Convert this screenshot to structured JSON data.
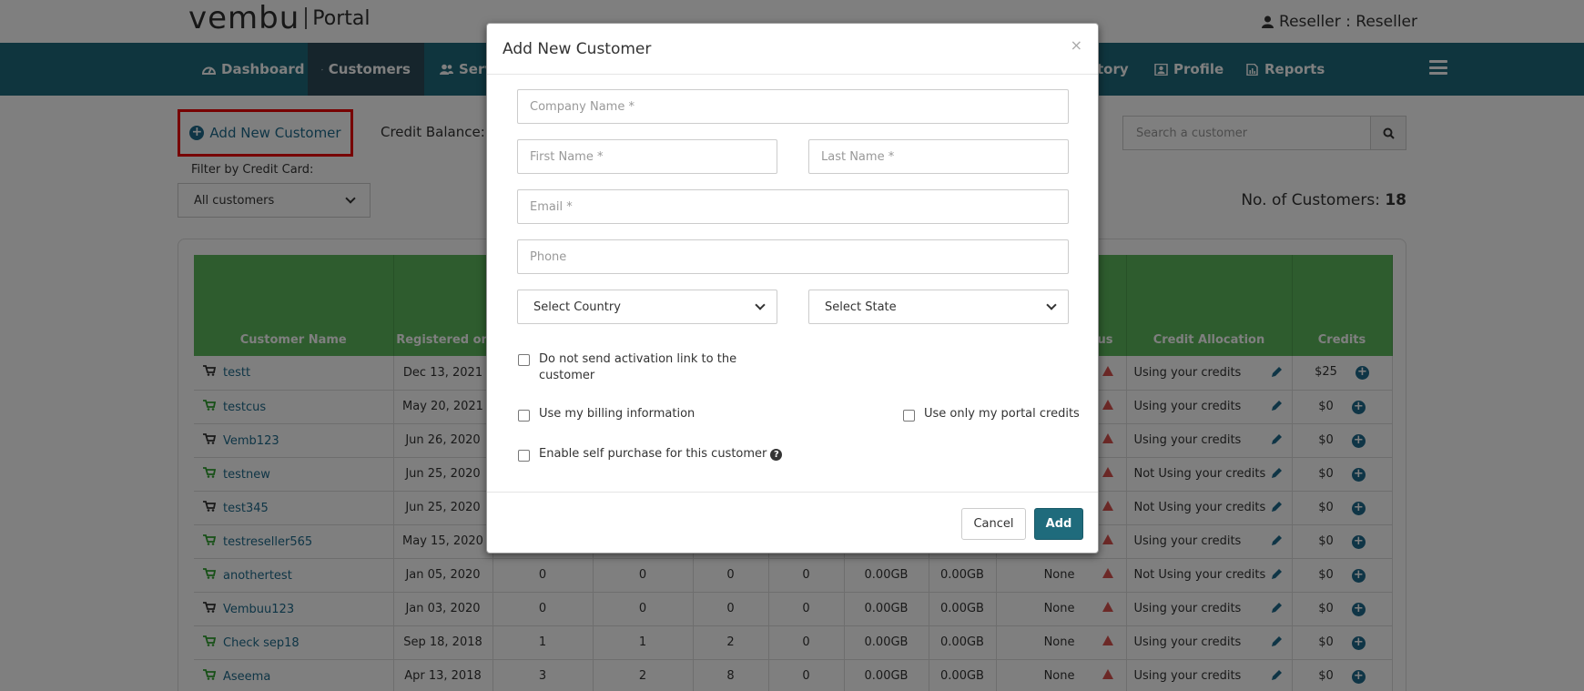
{
  "header": {
    "logo_brand": "vembu",
    "logo_portal": "Portal",
    "user_label": "Reseller : Reseller",
    "nav": [
      {
        "label": "Dashboard"
      },
      {
        "label": "Customers"
      },
      {
        "label": "Serv"
      },
      {
        "label": "tory"
      },
      {
        "label": "Profile"
      },
      {
        "label": "Reports"
      }
    ]
  },
  "toolbar": {
    "add_customer_label": "Add New Customer",
    "credit_balance_label": "Credit Balance:",
    "filter_label": "Filter by Credit Card:",
    "filter_value": "All customers",
    "search_placeholder": "Search a customer",
    "count_label": "No. of Customers:",
    "count_value": "18"
  },
  "table": {
    "columns": [
      "Customer Name",
      "Registered on",
      "",
      "",
      "",
      "",
      "",
      "",
      "us",
      "Credit Allocation",
      "Credits"
    ],
    "rows": [
      {
        "name": "testt",
        "cart_color": "#333333",
        "registered": "Dec 13, 2021",
        "c1": "",
        "c2": "",
        "c3": "",
        "c4": "",
        "c5": "",
        "c6": "",
        "c7": "",
        "alloc": "Using your credits",
        "credits": "$25"
      },
      {
        "name": "testcus",
        "cart_color": "#2ea12e",
        "registered": "May 20, 2021",
        "c1": "",
        "c2": "",
        "c3": "",
        "c4": "",
        "c5": "",
        "c6": "",
        "c7": "",
        "alloc": "Using your credits",
        "credits": "$0"
      },
      {
        "name": "Vemb123",
        "cart_color": "#333333",
        "registered": "Jun 26, 2020",
        "c1": "",
        "c2": "",
        "c3": "",
        "c4": "",
        "c5": "",
        "c6": "",
        "c7": "",
        "alloc": "Using your credits",
        "credits": "$0"
      },
      {
        "name": "testnew",
        "cart_color": "#2ea12e",
        "registered": "Jun 25, 2020",
        "c1": "",
        "c2": "",
        "c3": "",
        "c4": "",
        "c5": "",
        "c6": "",
        "c7": "",
        "alloc": "Not Using your credits",
        "credits": "$0"
      },
      {
        "name": "test345",
        "cart_color": "#333333",
        "registered": "Jun 25, 2020",
        "c1": "",
        "c2": "",
        "c3": "",
        "c4": "",
        "c5": "",
        "c6": "",
        "c7": "",
        "alloc": "Not Using your credits",
        "credits": "$0"
      },
      {
        "name": "testreseller565",
        "cart_color": "#2ea12e",
        "registered": "May 15, 2020",
        "c1": "",
        "c2": "",
        "c3": "",
        "c4": "",
        "c5": "",
        "c6": "",
        "c7": "",
        "alloc": "Using your credits",
        "credits": "$0"
      },
      {
        "name": "anothertest",
        "cart_color": "#2ea12e",
        "registered": "Jan 05, 2020",
        "c1": "0",
        "c2": "0",
        "c3": "0",
        "c4": "0",
        "c5": "0.00GB",
        "c6": "0.00GB",
        "c7": "None",
        "alloc": "Not Using your credits",
        "credits": "$0"
      },
      {
        "name": "Vembuu123",
        "cart_color": "#333333",
        "registered": "Jan 03, 2020",
        "c1": "0",
        "c2": "0",
        "c3": "0",
        "c4": "0",
        "c5": "0.00GB",
        "c6": "0.00GB",
        "c7": "None",
        "alloc": "Using your credits",
        "credits": "$0"
      },
      {
        "name": "Check sep18",
        "cart_color": "#2ea12e",
        "registered": "Sep 18, 2018",
        "c1": "1",
        "c2": "1",
        "c3": "2",
        "c4": "0",
        "c5": "0.00GB",
        "c6": "0.00GB",
        "c7": "None",
        "alloc": "Using your credits",
        "credits": "$0"
      },
      {
        "name": "Aseema",
        "cart_color": "#2ea12e",
        "registered": "Apr 13, 2018",
        "c1": "3",
        "c2": "2",
        "c3": "8",
        "c4": "0",
        "c5": "0.00GB",
        "c6": "0.00GB",
        "c7": "None",
        "alloc": "Using your credits",
        "credits": "$0"
      }
    ]
  },
  "modal": {
    "title": "Add New Customer",
    "close": "×",
    "company_placeholder": "Company  Name *",
    "first_name_placeholder": "First Name *",
    "last_name_placeholder": "Last Name *",
    "email_placeholder": "Email *",
    "phone_placeholder": "Phone",
    "country_value": "Select Country",
    "state_value": "Select State",
    "check_activation_line1": "Do not send activation link to the",
    "check_activation_line2": "customer",
    "check_billing": "Use my billing information",
    "check_portal_credits": "Use only my portal credits",
    "check_self_purchase": "Enable self purchase for this customer",
    "cancel_label": "Cancel",
    "add_label": "Add"
  },
  "colors": {
    "nav_bg": "#1f6b7c",
    "nav_active": "#2d4a59",
    "table_header": "#5cb85c",
    "link": "#1f6b8c",
    "highlight_border": "#ee0000",
    "warn": "#d9534f"
  }
}
